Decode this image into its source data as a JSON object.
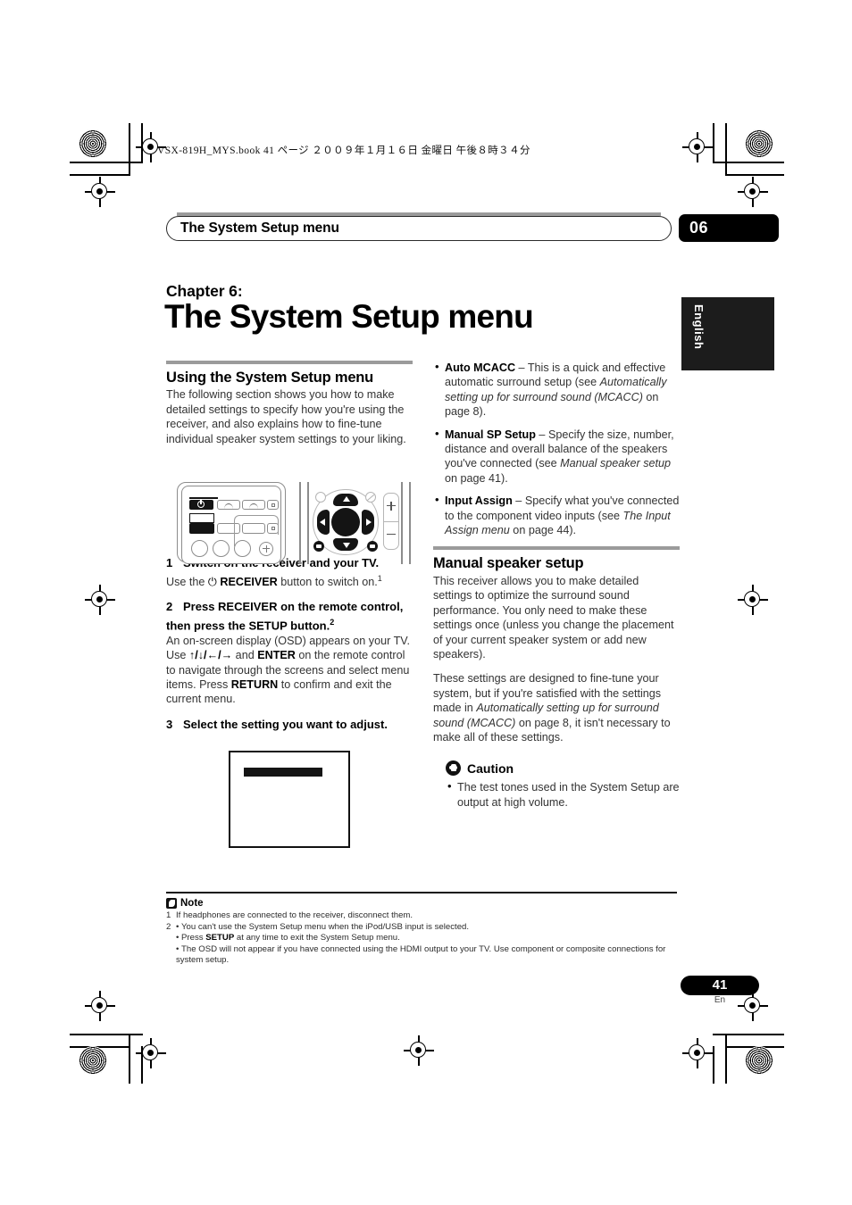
{
  "print": {
    "book_line": "VSX-819H_MYS.book   41 ページ   ２００９年１月１６日  金曜日  午後８時３４分"
  },
  "header": {
    "title": "The System Setup menu",
    "chapter_badge": "06",
    "language_tab": "English"
  },
  "chapter": {
    "label": "Chapter 6:",
    "title": "The System Setup menu"
  },
  "left_column": {
    "section_title": "Using the System Setup menu",
    "intro": "The following section shows you how to make detailed settings to specify how you're using the receiver, and also explains how to fine-tune individual speaker system settings to your liking.",
    "steps": [
      {
        "num": "1",
        "head": "Switch on the receiver and your TV.",
        "body_pre": "Use the ",
        "body_icon": "⏻",
        "body_bold": "RECEIVER",
        "body_post": " button to switch on.",
        "footnote_ref": "1"
      },
      {
        "num": "2",
        "head_line1": "Press RECEIVER on the remote control,",
        "head_line2": "then press the SETUP button.",
        "footnote_ref": "2",
        "body_1": "An on-screen display (OSD) appears on your TV. Use ",
        "body_arrows": "↑/↓/←/→",
        "body_2": " and ",
        "body_enter": "ENTER",
        "body_3": " on the remote control to navigate through the screens and select menu items. Press ",
        "body_return": "RETURN",
        "body_4": " to confirm and exit the current menu."
      },
      {
        "num": "3",
        "head": "Select the setting you want to adjust."
      }
    ]
  },
  "right_column": {
    "bullets": [
      {
        "term": "Auto MCACC",
        "dash": " – ",
        "text_1": "This is a quick and effective automatic surround setup (see ",
        "italic": "Automatically setting up for surround sound (MCACC)",
        "text_2": " on page 8)."
      },
      {
        "term": "Manual SP Setup",
        "dash": " – ",
        "text_1": "Specify the size, number, distance and overall balance of the speakers you've connected (see ",
        "italic": "Manual speaker setup",
        "text_2": " on page 41)."
      },
      {
        "term": "Input Assign",
        "dash": " – ",
        "text_1": "Specify what you've connected to the component video inputs (see ",
        "italic": "The Input Assign menu",
        "text_2": " on page 44)."
      }
    ],
    "section_title": "Manual speaker setup",
    "para_1": "This receiver allows you to make detailed settings to optimize the surround sound performance. You only need to make these settings once (unless you change the placement of your current speaker system or add new speakers).",
    "para_2_pre": "These settings are designed to fine-tune your system, but if you're satisfied with the settings made in ",
    "para_2_italic": "Automatically setting up for surround sound (MCACC)",
    "para_2_post": " on page 8, it isn't necessary to make all of these settings.",
    "caution_label": "Caution",
    "caution_items": [
      "The test tones used in the System Setup are output at high volume."
    ]
  },
  "footnotes": {
    "label": "Note",
    "items": [
      {
        "num": "1",
        "text": "If headphones are connected to the receiver, disconnect them."
      },
      {
        "num": "2",
        "text": "You can't use the System Setup menu when the iPod/USB input is selected."
      }
    ],
    "sub_items": [
      {
        "pre": "Press ",
        "bold": "SETUP",
        "post": " at any time to exit the System Setup menu."
      },
      {
        "pre": "The OSD will not appear if you have connected using the HDMI output to your TV. Use component or composite connections for system setup.",
        "bold": "",
        "post": ""
      }
    ]
  },
  "footer": {
    "page_number": "41",
    "page_lang": "En"
  }
}
